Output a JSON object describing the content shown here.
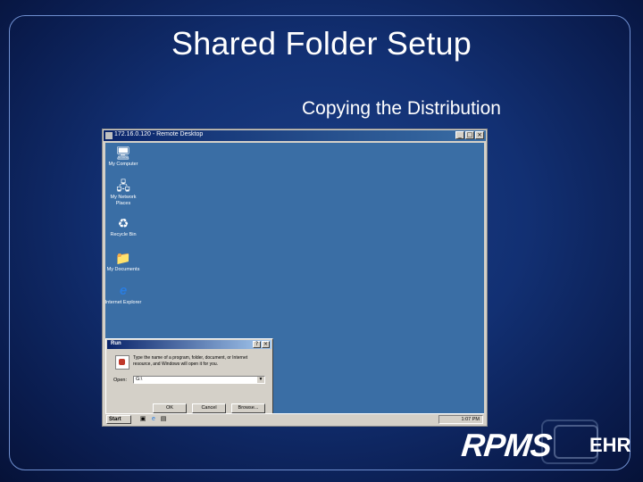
{
  "slide": {
    "title": "Shared Folder Setup",
    "subtitle": "Copying the Distribution"
  },
  "remote_window": {
    "title": "172.16.0.120 - Remote Desktop",
    "buttons": [
      "_",
      "□",
      "×"
    ]
  },
  "desktop_icons": [
    {
      "label": "My Computer",
      "icon": "my-computer-icon",
      "glyph": "🖥"
    },
    {
      "label": "My Network Places",
      "icon": "network-places-icon",
      "glyph": "🖧"
    },
    {
      "label": "Recycle Bin",
      "icon": "recycle-bin-icon",
      "glyph": "♻"
    },
    {
      "label": "My Documents",
      "icon": "my-documents-icon",
      "glyph": "📁"
    },
    {
      "label": "Internet Explorer",
      "icon": "internet-explorer-icon",
      "glyph": "e"
    }
  ],
  "run_dialog": {
    "title": "Run",
    "description": "Type the name of a program, folder, document, or Internet resource, and Windows will open it for you.",
    "open_label": "Open:",
    "open_value": "G:\\",
    "ok_label": "OK",
    "cancel_label": "Cancel",
    "browse_label": "Browse...",
    "caption_buttons": [
      "?",
      "×"
    ]
  },
  "taskbar": {
    "start_label": "Start",
    "clock": "1:07 PM"
  },
  "logo": {
    "primary": "RPMS",
    "secondary": "EHR"
  }
}
